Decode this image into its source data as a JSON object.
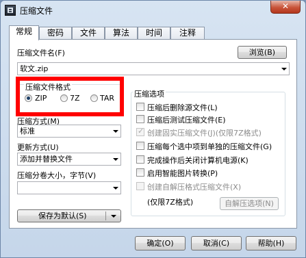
{
  "window": {
    "title": "压缩文件",
    "close_glyph": "✕"
  },
  "tabs": [
    {
      "label": "常规",
      "active": true
    },
    {
      "label": "密码"
    },
    {
      "label": "文件"
    },
    {
      "label": "算法"
    },
    {
      "label": "时间"
    },
    {
      "label": "注释"
    }
  ],
  "filename": {
    "label": "压缩文件名(F)",
    "browse_label": "浏览(B)",
    "value": "软文.zip"
  },
  "format": {
    "label": "压缩文件格式",
    "options": [
      "ZIP",
      "7Z",
      "TAR"
    ],
    "selected": "ZIP"
  },
  "method": {
    "label": "压缩方式(M)",
    "value": "标准"
  },
  "update": {
    "label": "更新方式(U)",
    "value": "添加并替换文件"
  },
  "split": {
    "label": "压缩分卷大小，字节(V)",
    "value": ""
  },
  "save_default": {
    "label": "保存为默认(S)"
  },
  "options": {
    "title": "压缩选项",
    "items": [
      {
        "label": "压缩后删除源文件(L)",
        "checked": false,
        "disabled": false
      },
      {
        "label": "压缩后测试压缩文件(E)",
        "checked": false,
        "disabled": false
      },
      {
        "label": "创建固实压缩文件(J)(仅限7Z格式)",
        "checked": true,
        "disabled": true
      },
      {
        "label": "压缩每个选中项到单独的压缩文件(G)",
        "checked": false,
        "disabled": false
      },
      {
        "label": "完成操作后关闭计算机电源(K)",
        "checked": false,
        "disabled": false
      },
      {
        "label": "启用智能图片转换(P)",
        "checked": false,
        "disabled": false
      },
      {
        "label": "创建自解压格式压缩文件(X)",
        "checked": false,
        "disabled": true
      }
    ],
    "sfx_note": "(仅限7Z格式)",
    "sfx_button": "自解压选项(N)"
  },
  "footer": {
    "ok": "确定(O)",
    "cancel": "取消(C)",
    "help": "帮助(H)"
  },
  "highlight_color": "#ff0000"
}
